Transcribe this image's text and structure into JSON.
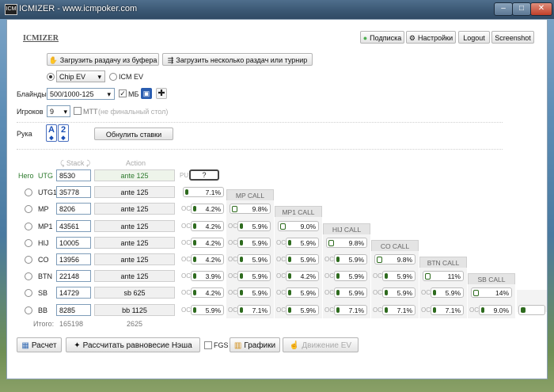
{
  "window": {
    "title": "ICMIZER - www.icmpoker.com",
    "icon_label": "ICM",
    "min_glyph": "–",
    "max_glyph": "□",
    "close_glyph": "✕"
  },
  "header": {
    "logo": "ICMIZER",
    "subscription_label": "Подписка",
    "settings_label": "Настройки",
    "logout_label": "Logout",
    "screenshot_label": "Screenshot"
  },
  "load": {
    "from_buffer_label": "Загрузить раздачу из буфера",
    "multi_label": "Загрузить несколько раздач или турнир"
  },
  "model": {
    "chip_ev_selected": "Chip EV",
    "icm_ev_label": "ICM EV"
  },
  "blinds": {
    "label": "Блайнды",
    "value": "500/1000-125",
    "mb_label": "МБ"
  },
  "players": {
    "label": "Игроков",
    "value": "9",
    "mtt_label": "МТТ",
    "mtt_note": "(не финальный стол)"
  },
  "hand": {
    "label": "Руку",
    "label_text": "Рука",
    "cards": [
      "A",
      "2"
    ],
    "reset_label": "Обнулить ставки"
  },
  "table": {
    "stack_header": "Stack",
    "action_header": "Action",
    "pu_label": "PU",
    "pu_value": "?",
    "hero_label": "Hero",
    "total_label": "Итого:",
    "total_stack": "165198",
    "total_action": "2625",
    "rows": [
      {
        "pos": "UTG",
        "stack": "8530",
        "action": "ante 125",
        "hero": true
      },
      {
        "pos": "UTG1",
        "stack": "35778",
        "action": "ante 125"
      },
      {
        "pos": "MP",
        "stack": "8206",
        "action": "ante 125"
      },
      {
        "pos": "MP1",
        "stack": "43561",
        "action": "ante 125"
      },
      {
        "pos": "HIJ",
        "stack": "10005",
        "action": "ante 125"
      },
      {
        "pos": "CO",
        "stack": "13956",
        "action": "ante 125"
      },
      {
        "pos": "BTN",
        "stack": "22148",
        "action": "ante 125"
      },
      {
        "pos": "SB",
        "stack": "14729",
        "action": "sb 625"
      },
      {
        "pos": "BB",
        "stack": "8285",
        "action": "bb 1125"
      }
    ],
    "oc_label": "OC",
    "call_headers": [
      "MP CALL",
      "MP1 CALL",
      "HIJ CALL",
      "CO CALL",
      "BTN CALL",
      "SB CALL"
    ],
    "col_utg1": [
      "7.1%",
      "4.2%",
      "4.2%",
      "4.2%",
      "4.2%",
      "3.9%",
      "4.2%",
      "5.9%"
    ],
    "col_mp": [
      "9.8%",
      "5.9%",
      "5.9%",
      "5.9%",
      "5.9%",
      "5.9%",
      "7.1%"
    ],
    "col_mp1": [
      "9.0%",
      "5.9%",
      "5.9%",
      "4.2%",
      "5.9%",
      "5.9%"
    ],
    "col_hij": [
      "9.8%",
      "5.9%",
      "5.9%",
      "5.9%",
      "7.1%"
    ],
    "col_co": [
      "9.8%",
      "5.9%",
      "5.9%",
      "7.1%"
    ],
    "col_btn": [
      "11%",
      "5.9%",
      "7.1%"
    ],
    "col_sb": [
      "14%",
      "9.0%"
    ]
  },
  "footer": {
    "calc_label": "Расчет",
    "nash_label": "Рассчитать равновесие Нэша",
    "fgs_label": "FGS",
    "graphs_label": "Графики",
    "ev_move_label": "Движение EV"
  },
  "colors": {
    "accent_green": "#2e6b1e",
    "hero_green": "#2c7a2c"
  }
}
